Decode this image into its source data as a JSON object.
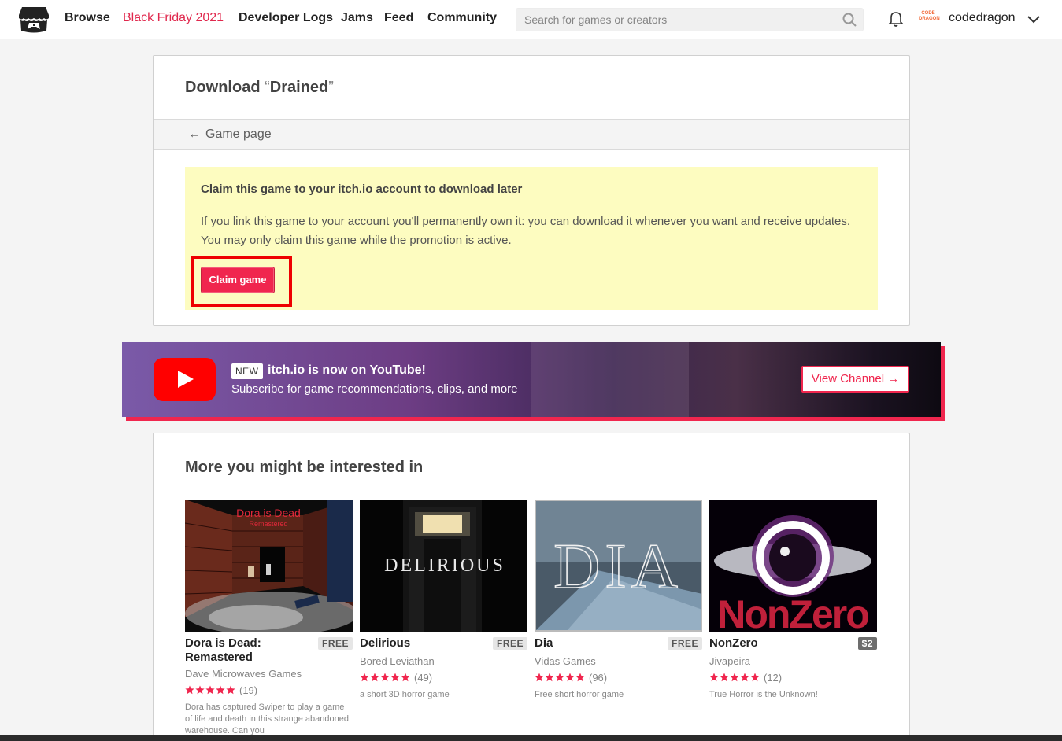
{
  "header": {
    "nav": [
      "Browse",
      "Black Friday 2021",
      "Developer Logs",
      "Jams",
      "Feed",
      "Community"
    ],
    "search_placeholder": "Search for games or creators",
    "avatar_text": "CODE DRAGON",
    "username": "codedragon"
  },
  "download": {
    "title_prefix": "Download ",
    "open_quote": "“",
    "game_name": "Drained",
    "close_quote": "”",
    "back_link": "Game page",
    "claim": {
      "heading": "Claim this game to your itch.io account to download later",
      "body": "If you link this game to your account you'll permanently own it: you can download it whenever you want and receive updates. You may only claim this game while the promotion is active.",
      "button": "Claim game"
    }
  },
  "youtube_banner": {
    "badge": "NEW",
    "title": "itch.io is now on YouTube!",
    "subtitle": "Subscribe for game recommendations, clips, and more",
    "button": "View Channel →"
  },
  "more": {
    "heading": "More you might be interested in",
    "games": [
      {
        "title": "Dora is Dead: Remastered",
        "price": "FREE",
        "author": "Dave Microwaves Games",
        "rating_count": "(19)",
        "desc": "Dora has captured Swiper to play a game of life and death in this strange abandoned warehouse. Can you",
        "thumb_text": "Dora is Dead",
        "thumb_sub": "Remastered"
      },
      {
        "title": "Delirious",
        "price": "FREE",
        "author": "Bored Leviathan",
        "rating_count": "(49)",
        "desc": "a short 3D horror game",
        "thumb_text": "DELIRIOUS"
      },
      {
        "title": "Dia",
        "price": "FREE",
        "author": "Vidas Games",
        "rating_count": "(96)",
        "desc": "Free short horror game",
        "thumb_text": "DIA"
      },
      {
        "title": "NonZero",
        "price": "$2",
        "author": "Jivapeira",
        "rating_count": "(12)",
        "desc": "True Horror is the Unknown!",
        "thumb_text": "NonZero"
      }
    ]
  },
  "colors": {
    "accent": "#f0264e",
    "highlight_frame": "#ee0000",
    "claim_bg": "#fdfcc0"
  }
}
